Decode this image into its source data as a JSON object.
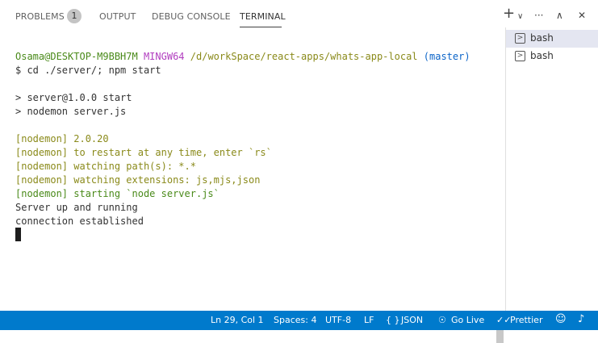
{
  "panel": {
    "tabs": [
      {
        "label": "PROBLEMS",
        "badge": "1"
      },
      {
        "label": "OUTPUT"
      },
      {
        "label": "DEBUG CONSOLE"
      },
      {
        "label": "TERMINAL"
      }
    ],
    "active_tab": "TERMINAL"
  },
  "toolbar": {
    "add_glyph": "+",
    "split_glyph": "∨",
    "more_glyph": "···",
    "maximize_glyph": "∧",
    "close_glyph": "✕"
  },
  "terminal": {
    "prompt": {
      "user_host": "Osama@DESKTOP-M9BBH7M",
      "env": "MINGW64",
      "path": "/d/workSpace/react-apps/whats-app-local",
      "branch": "(master)"
    },
    "lines": [
      "$ cd ./server/; npm start",
      "",
      "> server@1.0.0 start",
      "> nodemon server.js",
      "",
      "[nodemon] 2.0.20",
      "[nodemon] to restart at any time, enter `rs`",
      "[nodemon] watching path(s): *.*",
      "[nodemon] watching extensions: js,mjs,json",
      "[nodemon] starting `node server.js`",
      "Server up and running",
      "connection established"
    ]
  },
  "terminals_list": {
    "items": [
      {
        "label": "bash",
        "icon_glyph": ">"
      },
      {
        "label": "bash",
        "icon_glyph": ">"
      }
    ]
  },
  "statusbar": {
    "position": "Ln 29, Col 1",
    "spaces": "Spaces: 4",
    "encoding": "UTF-8",
    "eol": "LF",
    "language_glyph": "{ }",
    "language": "JSON",
    "golive_glyph": "☉",
    "golive": "Go Live",
    "prettier_glyph": "✓✓",
    "prettier": "Prettier",
    "feedback_glyph": "☺",
    "bell_glyph": "♪"
  }
}
